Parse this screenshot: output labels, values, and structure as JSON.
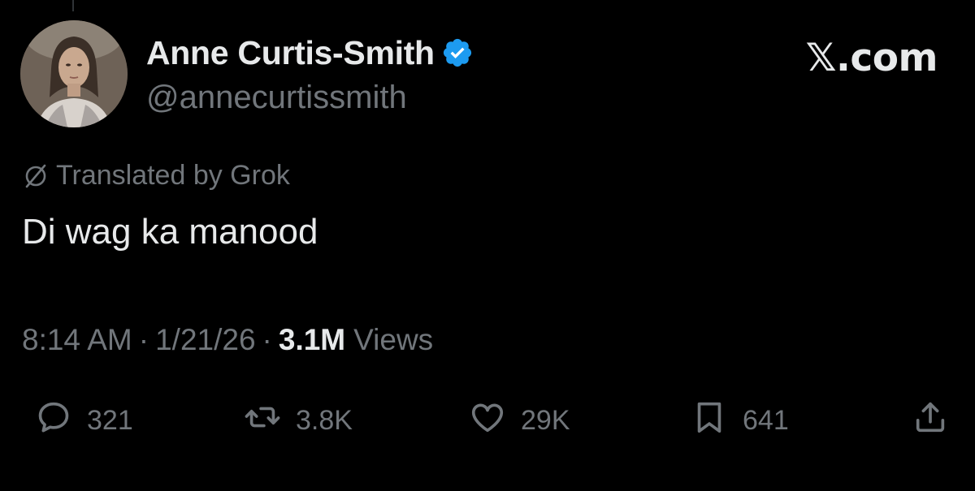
{
  "author": {
    "display_name": "Anne Curtis-Smith",
    "handle": "@annecurtissmith",
    "verified": true,
    "verified_color": "#1d9bf0"
  },
  "brand": "𝕏.com",
  "translation": {
    "icon": "grok-icon",
    "label": "Translated by Grok"
  },
  "tweet": {
    "text": "Di wag ka manood"
  },
  "meta": {
    "time": "8:14 AM",
    "date": "1/21/26",
    "views_count": "3.1M",
    "views_label": "Views"
  },
  "actions": {
    "reply": {
      "icon": "reply-icon",
      "count": "321"
    },
    "retweet": {
      "icon": "retweet-icon",
      "count": "3.8K"
    },
    "like": {
      "icon": "heart-icon",
      "count": "29K"
    },
    "bookmark": {
      "icon": "bookmark-icon",
      "count": "641"
    },
    "share": {
      "icon": "share-icon"
    }
  },
  "colors": {
    "background": "#000000",
    "primary_text": "#e7e9ea",
    "secondary_text": "#71767b"
  }
}
